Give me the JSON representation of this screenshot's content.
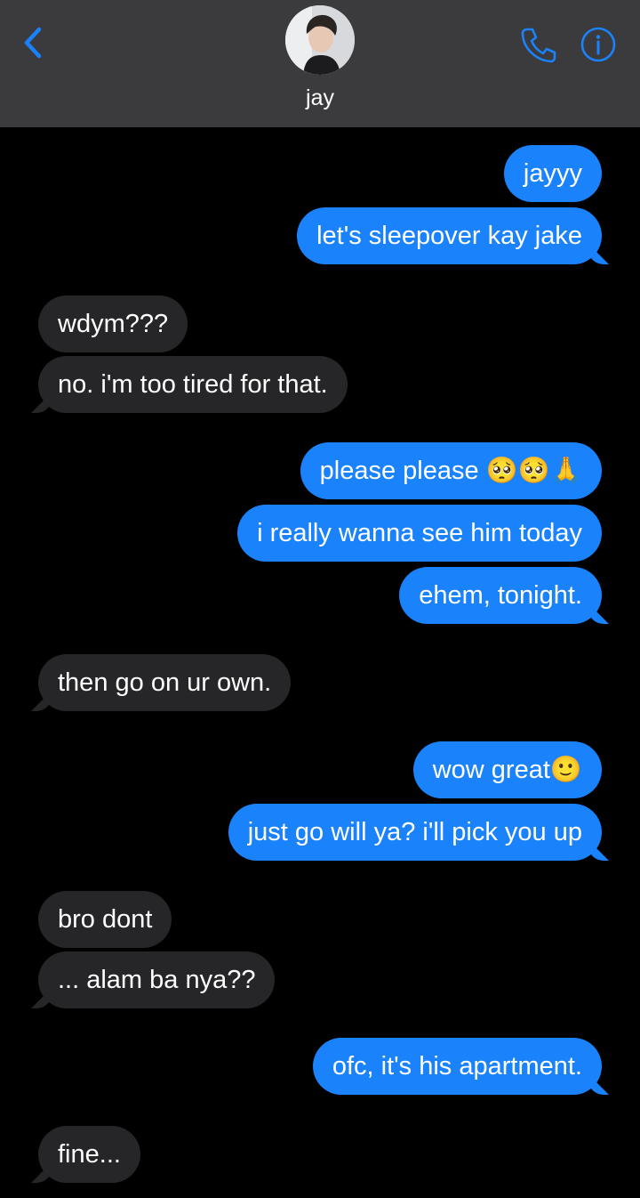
{
  "header": {
    "contact_name": "jay",
    "back_icon": "chevron-left-icon",
    "call_icon": "phone-icon",
    "info_icon": "info-icon",
    "accent_color": "#1a82fb"
  },
  "messages": [
    {
      "direction": "outgoing",
      "text": "jayyy"
    },
    {
      "direction": "outgoing",
      "text": "let's sleepover kay jake"
    },
    {
      "direction": "incoming",
      "text": "wdym???"
    },
    {
      "direction": "incoming",
      "text": "no. i'm too tired for that."
    },
    {
      "direction": "outgoing",
      "text": "please please 🥺🥺🙏"
    },
    {
      "direction": "outgoing",
      "text": "i really wanna see him today"
    },
    {
      "direction": "outgoing",
      "text": "ehem, tonight."
    },
    {
      "direction": "incoming",
      "text": "then go on ur own."
    },
    {
      "direction": "outgoing",
      "text": "wow great🙂"
    },
    {
      "direction": "outgoing",
      "text": "just go will ya? i'll pick you up"
    },
    {
      "direction": "incoming",
      "text": "bro dont"
    },
    {
      "direction": "incoming",
      "text": "... alam ba nya??"
    },
    {
      "direction": "outgoing",
      "text": "ofc, it's his apartment."
    },
    {
      "direction": "incoming",
      "text": "fine..."
    }
  ]
}
